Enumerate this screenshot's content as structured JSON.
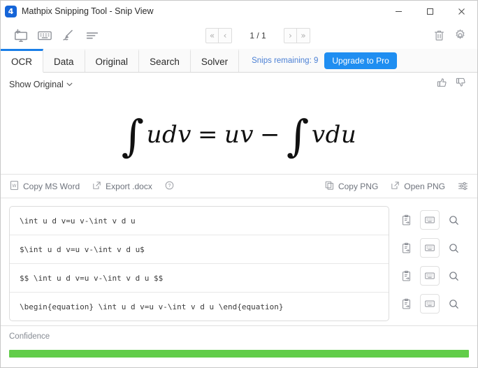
{
  "window": {
    "title": "Mathpix Snipping Tool - Snip View",
    "logo_glyph": "4",
    "controls": {
      "minimize": "minimize-icon",
      "maximize": "maximize-icon",
      "close": "close-icon"
    }
  },
  "toolbar": {
    "icons": [
      "snip-icon",
      "keyboard-icon",
      "pen-icon",
      "lines-icon"
    ],
    "right_icons": [
      "trash-icon",
      "gear-icon"
    ],
    "nav": {
      "first": "«",
      "prev": "‹",
      "next": "›",
      "last": "»",
      "page_indicator": "1 / 1"
    }
  },
  "tabs": [
    {
      "label": "OCR",
      "active": true
    },
    {
      "label": "Data",
      "active": false
    },
    {
      "label": "Original",
      "active": false
    },
    {
      "label": "Search",
      "active": false
    },
    {
      "label": "Solver",
      "active": false
    }
  ],
  "account": {
    "snips_remaining_label": "Snips remaining: 9",
    "upgrade_label": "Upgrade to Pro",
    "accent_color": "#1f8ef1"
  },
  "show_row": {
    "label": "Show Original",
    "thumbs_up": "thumbs-up-icon",
    "thumbs_down": "thumbs-down-icon"
  },
  "preview": {
    "integral": "∫",
    "lhs": "udv",
    "equals": "=",
    "mid": "uv",
    "minus": "−",
    "rhs": "vdu"
  },
  "export_bar": {
    "copy_word": "Copy MS Word",
    "export_docx": "Export .docx",
    "help": "?",
    "copy_png": "Copy PNG",
    "open_png": "Open PNG",
    "settings": "sliders-icon"
  },
  "results": [
    {
      "text": "\\int u d v=u v-\\int v d u"
    },
    {
      "text": "$\\int u d v=u v-\\int v d u$"
    },
    {
      "text": "$$  \\int u d v=u v-\\int v d u  $$"
    },
    {
      "text": "\\begin{equation}  \\int u d v=u v-\\int v d u  \\end{equation}"
    }
  ],
  "row_buttons": {
    "copy": "copy-clipboard-icon",
    "keyboard": "keyboard-icon",
    "search": "search-icon"
  },
  "confidence": {
    "label": "Confidence",
    "percent": 100,
    "color": "#62cd4a"
  }
}
